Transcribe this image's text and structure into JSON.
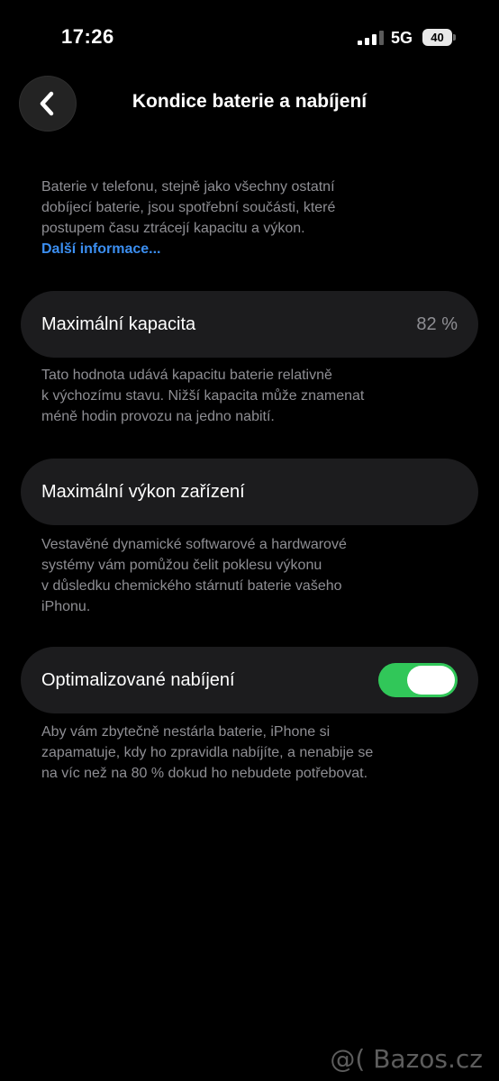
{
  "status_bar": {
    "time": "17:26",
    "network": "5G",
    "battery_level": "40",
    "signal_icon": "cellular-signal-icon",
    "battery_icon": "battery-icon"
  },
  "nav": {
    "title": "Kondice baterie a nabíjení",
    "back_icon": "chevron-left-icon"
  },
  "intro": {
    "lines": [
      "Baterie v telefonu, stejně jako všechny ostatní",
      "dobíjecí baterie, jsou spotřební součásti, které",
      "postupem času ztrácejí kapacitu a výkon."
    ],
    "link": "Další informace..."
  },
  "max_capacity": {
    "label": "Maximální kapacita",
    "value": "82 %",
    "footnote": [
      "Tato hodnota udává kapacitu baterie relativně",
      "k výchozímu stavu. Nižší kapacita může znamenat",
      "méně hodin provozu na jedno nabití."
    ]
  },
  "max_performance": {
    "label": "Maximální výkon zařízení",
    "footnote": [
      "Vestavěné dynamické softwarové a hardwarové",
      "systémy vám pomůžou čelit poklesu výkonu",
      "v důsledku chemického stárnutí baterie vašeho",
      "iPhonu."
    ]
  },
  "optimized_charging": {
    "label": "Optimalizované nabíjení",
    "enabled": true,
    "toggle_color": "#31c759",
    "footnote": [
      "Aby vám zbytečně nestárla baterie, iPhone si",
      "zapamatuje, kdy ho zpravidla nabíjíte, a nenabije se",
      "na víc než na 80 % dokud ho nebudete potřebovat."
    ]
  },
  "watermark": "@( Bazos.cz"
}
